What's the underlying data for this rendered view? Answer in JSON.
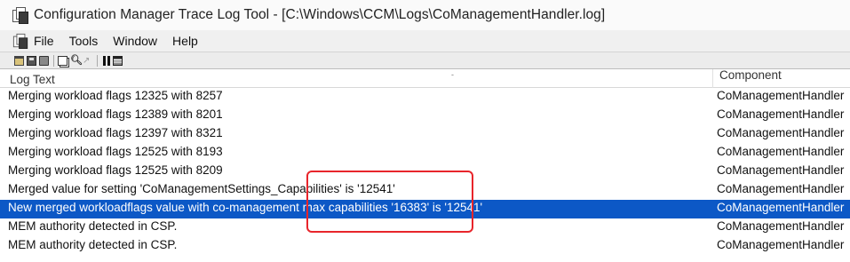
{
  "window": {
    "title": "Configuration Manager Trace Log Tool - [C:\\Windows\\CCM\\Logs\\CoManagementHandler.log]"
  },
  "menu": {
    "items": [
      {
        "label": "File"
      },
      {
        "label": "Tools"
      },
      {
        "label": "Window"
      },
      {
        "label": "Help"
      }
    ]
  },
  "toolbar": {
    "icons": [
      "open-icon",
      "save-icon",
      "print-icon",
      "copy-icon",
      "find-icon",
      "error-lookup-icon",
      "pause-icon",
      "columns-icon"
    ]
  },
  "log": {
    "columns": {
      "text": "Log Text",
      "component": "Component"
    },
    "rows": [
      {
        "text": "Merging workload flags 12325 with 8257",
        "component": "CoManagementHandler"
      },
      {
        "text": "Merging workload flags 12389 with 8201",
        "component": "CoManagementHandler"
      },
      {
        "text": "Merging workload flags 12397 with 8321",
        "component": "CoManagementHandler"
      },
      {
        "text": "Merging workload flags 12525 with 8193",
        "component": "CoManagementHandler"
      },
      {
        "text": "Merging workload flags 12525 with 8209",
        "component": "CoManagementHandler"
      },
      {
        "text": "Merged value for setting 'CoManagementSettings_Capabilities' is '12541'",
        "component": "CoManagementHandler"
      },
      {
        "text": "New merged workloadflags value with co-management max capabilities '16383' is '12541'",
        "component": "CoManagementHandler",
        "selected": true
      },
      {
        "text": "MEM authority detected in CSP.",
        "component": "CoManagementHandler"
      },
      {
        "text": "MEM authority detected in CSP.",
        "component": "CoManagementHandler"
      }
    ]
  },
  "colors": {
    "selection": "#0c58c6",
    "annotation": "#e8252b"
  }
}
